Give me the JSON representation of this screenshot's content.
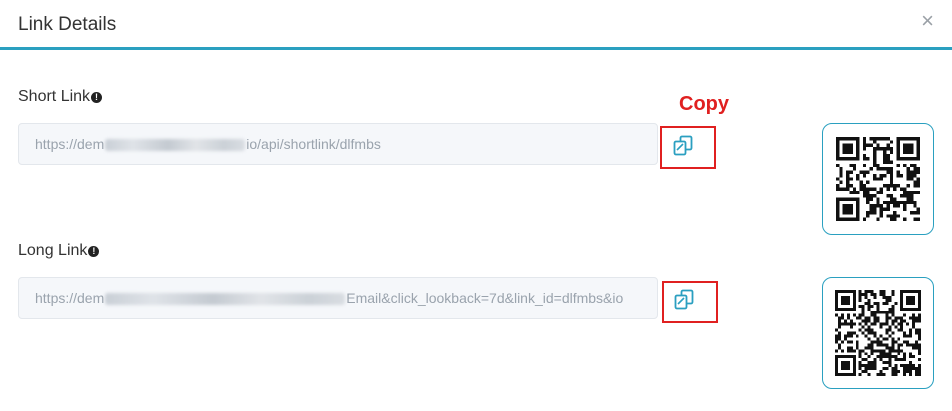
{
  "modal": {
    "title": "Link Details",
    "close_label": "×"
  },
  "short_link": {
    "label": "Short Link",
    "info": "!",
    "value_prefix": "https://dem",
    "value_suffix": "io/api/shortlink/dlfmbs"
  },
  "long_link": {
    "label": "Long Link",
    "info": "!",
    "value_prefix": "https://dem",
    "value_suffix": "Email&click_lookback=7d&link_id=dlfmbs&io"
  },
  "annotation": {
    "text": "Copy",
    "color": "#e02020"
  },
  "icons": {
    "copy": "copy-icon",
    "qr": "qr-code-icon",
    "close": "close-icon",
    "info": "info-icon"
  },
  "colors": {
    "accent": "#2aa0c0",
    "annotation_red": "#e02020"
  }
}
